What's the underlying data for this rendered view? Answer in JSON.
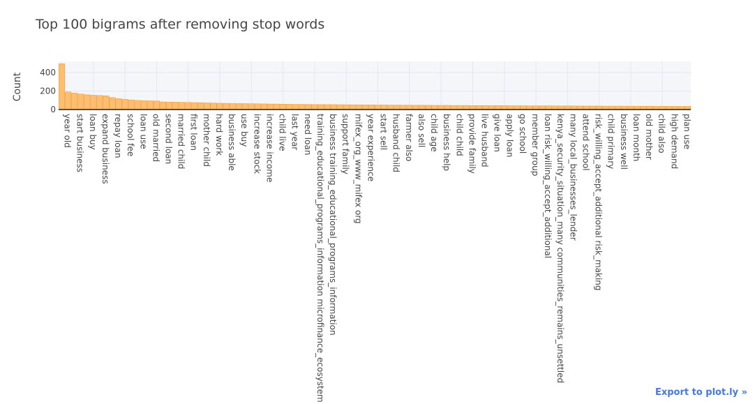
{
  "export_link": "Export to plot.ly »",
  "chart_data": {
    "type": "bar",
    "title": "Top 100 bigrams after removing stop words",
    "xlabel": "",
    "ylabel": "Count",
    "ylim": [
      0,
      520
    ],
    "yticks": [
      0,
      200,
      400
    ],
    "grid": true,
    "bar_color": "#fdbf6f",
    "bar_edge_color": "#f0a048",
    "grid_color": "#e4e7ef",
    "plot_bg": "#f5f6fa",
    "categories": [
      "year old",
      "start business",
      "loan buy",
      "expand business",
      "repay loan",
      "school fee",
      "loan use",
      "old married",
      "second loan",
      "married child",
      "first loan",
      "mother child",
      "hard work",
      "business able",
      "use buy",
      "increase stock",
      "increase income",
      "child live",
      "last year",
      "need loan",
      "training_educational_programs_information microfinance_ecosystem",
      "business training_educational_programs_information",
      "support family",
      "mifex_org_www_mifex org",
      "year experience",
      "start sell",
      "husband child",
      "farmer also",
      "also sell",
      "child age",
      "business help",
      "child child",
      "provide family",
      "live husband",
      "give loan",
      "apply loan",
      "go school",
      "member group",
      "loan risk_willing_accept_additional",
      "kenya_security_situation_many communities_remains_unsettled",
      "many local_businesses_lender",
      "attend school",
      "risk_willing_accept_additional risk_making",
      "child primary",
      "business well",
      "loan month",
      "old mother",
      "child also",
      "high demand",
      "plan use"
    ],
    "values": [
      495,
      190,
      178,
      168,
      160,
      155,
      152,
      148,
      130,
      118,
      110,
      104,
      99,
      96,
      94,
      93,
      82,
      81,
      80,
      78,
      77,
      75,
      74,
      72,
      70,
      68,
      67,
      66,
      65,
      64,
      63,
      62,
      61,
      60,
      59,
      58,
      57,
      56,
      56,
      55,
      54,
      54,
      53,
      53,
      52,
      52,
      51,
      51,
      50,
      50,
      49,
      49,
      48,
      48,
      47,
      47,
      46,
      46,
      46,
      45,
      45,
      45,
      44,
      44,
      44,
      43,
      43,
      43,
      42,
      42,
      42,
      41,
      41,
      41,
      40,
      40,
      40,
      40,
      39,
      39,
      39,
      39,
      38,
      38,
      38,
      38,
      37,
      37,
      37,
      37,
      36,
      36,
      36,
      36,
      35,
      35,
      35,
      35,
      34,
      34
    ]
  }
}
